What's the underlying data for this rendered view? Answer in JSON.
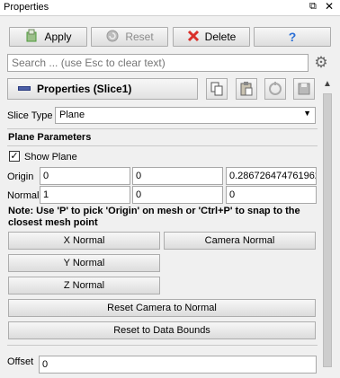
{
  "panel": {
    "title": "Properties"
  },
  "toolbar": {
    "apply_label": "Apply",
    "reset_label": "Reset",
    "delete_label": "Delete",
    "help_label": "?"
  },
  "search": {
    "placeholder": "Search ... (use Esc to clear text)"
  },
  "properties_header": {
    "label": "Properties (Slice1)"
  },
  "slice_type": {
    "label": "Slice Type",
    "value": "Plane"
  },
  "plane_parameters": {
    "heading": "Plane Parameters",
    "show_plane_label": "Show Plane",
    "show_plane_checked": true,
    "origin_label": "Origin",
    "origin": [
      "0",
      "0",
      "0.286726474761962"
    ],
    "normal_label": "Normal",
    "normal": [
      "1",
      "0",
      "0"
    ],
    "note": "Note: Use 'P' to pick 'Origin' on mesh or 'Ctrl+P' to snap to the closest mesh point",
    "x_normal": "X Normal",
    "camera_normal": "Camera Normal",
    "y_normal": "Y Normal",
    "z_normal": "Z Normal",
    "reset_camera": "Reset Camera to Normal",
    "reset_bounds": "Reset to Data Bounds"
  },
  "offset": {
    "label": "Offset",
    "value": "0"
  },
  "colors": {
    "properties_icon": "#4b5ea6",
    "delete_x": "#d9302a",
    "help": "#2a6fd6",
    "apply_green": "#4c9a3a"
  }
}
